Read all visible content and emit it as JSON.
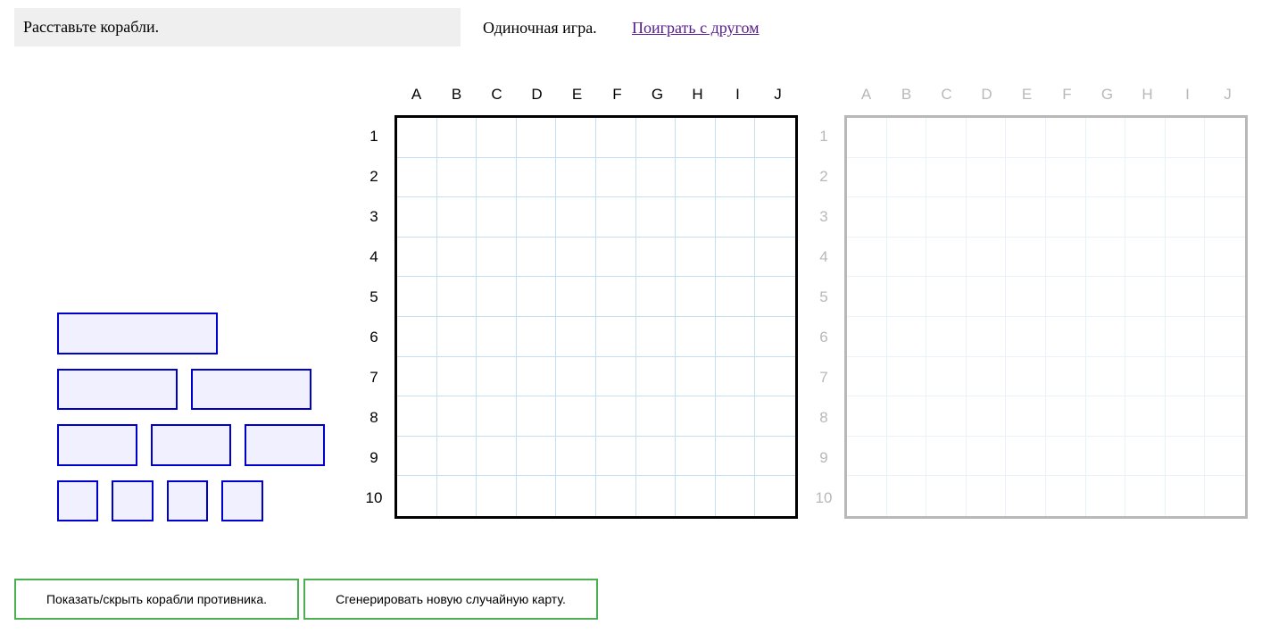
{
  "status": {
    "message": "Расставьте корабли."
  },
  "mode": {
    "current": "Одиночная игра.",
    "switch_link": "Поиграть с другом"
  },
  "columns": [
    "A",
    "B",
    "C",
    "D",
    "E",
    "F",
    "G",
    "H",
    "I",
    "J"
  ],
  "rows": [
    "1",
    "2",
    "3",
    "4",
    "5",
    "6",
    "7",
    "8",
    "9",
    "10"
  ],
  "boards": {
    "player": {
      "state": "active"
    },
    "enemy": {
      "state": "inactive"
    }
  },
  "fleet": [
    {
      "size": 4,
      "state": "unplaced"
    },
    {
      "size": 3,
      "state": "unplaced"
    },
    {
      "size": 3,
      "state": "unplaced"
    },
    {
      "size": 2,
      "state": "unplaced"
    },
    {
      "size": 2,
      "state": "unplaced"
    },
    {
      "size": 2,
      "state": "unplaced"
    },
    {
      "size": 1,
      "state": "unplaced"
    },
    {
      "size": 1,
      "state": "unplaced"
    },
    {
      "size": 1,
      "state": "unplaced"
    },
    {
      "size": 1,
      "state": "unplaced"
    }
  ],
  "buttons": {
    "toggle_enemy": "Показать/скрыть корабли противника.",
    "random_map": "Сгенерировать новую случайную карту."
  },
  "colors": {
    "ship_border": "#0000cc",
    "ship_fill": "#f0f0ff",
    "player_grid_border": "#000000",
    "enemy_grid_border": "#b8b8b8",
    "button_border": "#4caf50",
    "link": "#551a8b"
  }
}
